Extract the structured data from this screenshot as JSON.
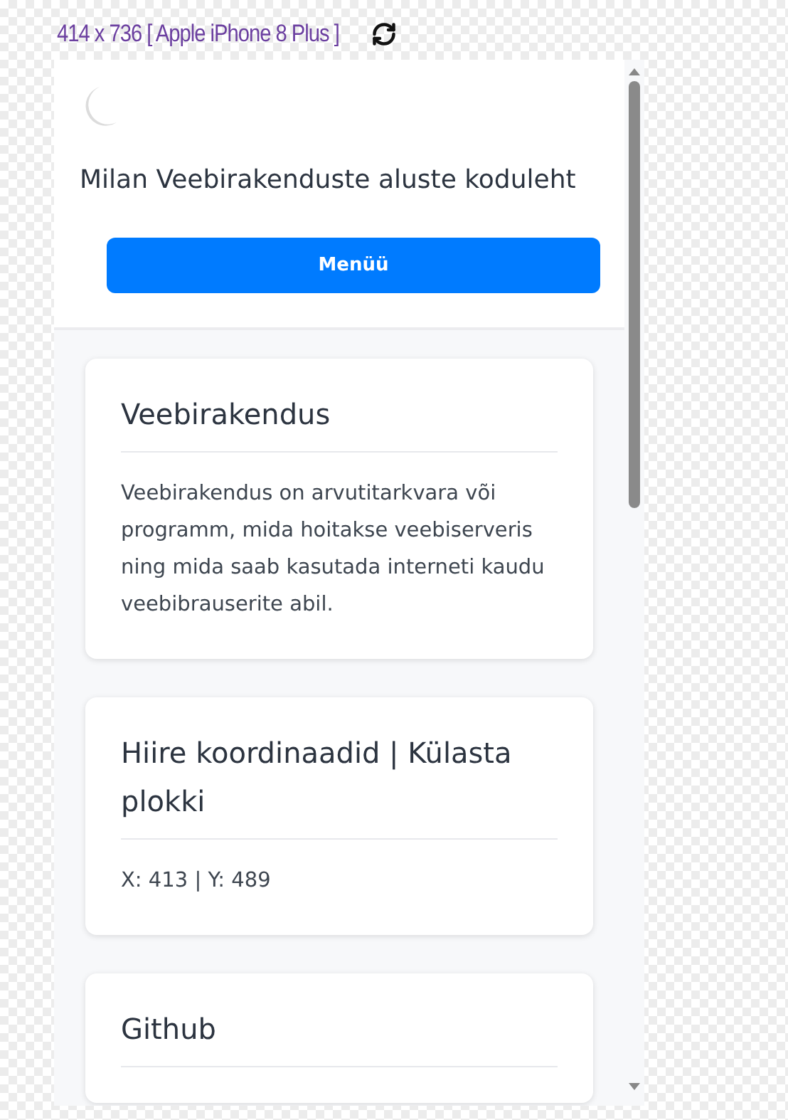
{
  "device_label": "414 x 736 [ Apple iPhone 8 Plus ]",
  "header": {
    "title": "Milan Veebirakenduste aluste koduleht",
    "menu_button": "Menüü"
  },
  "cards": [
    {
      "title": "Veebirakendus",
      "body": "Veebirakendus on arvutitarkvara või programm, mida hoitakse veebiserveris ning mida saab kasutada interneti kaudu veebibrauserite abil."
    },
    {
      "title": "Hiire koordinaadid | Külasta plokki",
      "body": "X: 413 | Y: 489"
    },
    {
      "title": "Github"
    }
  ]
}
